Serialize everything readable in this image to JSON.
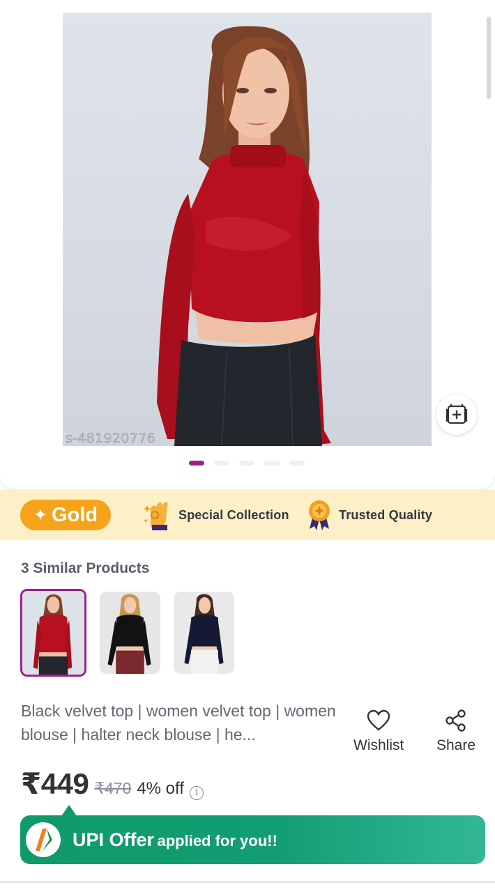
{
  "gallery": {
    "catalog_id": "s-481920776",
    "slide_count": 5,
    "active_slide": 0
  },
  "badges": {
    "gold_label": "Gold",
    "special_collection": "Special Collection",
    "trusted_quality": "Trusted Quality"
  },
  "similar": {
    "title": "3 Similar Products",
    "items": [
      {
        "top_color": "#b8101e",
        "bottom_color": "#23262d",
        "selected": true
      },
      {
        "top_color": "#121214",
        "bottom_color": "#7a2a2e",
        "selected": false
      },
      {
        "top_color": "#141a33",
        "bottom_color": "#f2f2f2",
        "selected": false
      }
    ]
  },
  "product": {
    "title": "Black velvet top | women velvet top | women blouse | halter neck blouse | he...",
    "price": "₹449",
    "mrp": "₹470",
    "discount": "4% off"
  },
  "actions": {
    "wishlist": "Wishlist",
    "share": "Share"
  },
  "upi_offer": {
    "main": "UPI Offer",
    "rest": "applied for you!!"
  },
  "colors": {
    "brand_purple": "#9f2089",
    "gold": "#f6a31a",
    "upi_green": "#0e9a6a",
    "gold_strip_bg": "#fdf0c7"
  }
}
